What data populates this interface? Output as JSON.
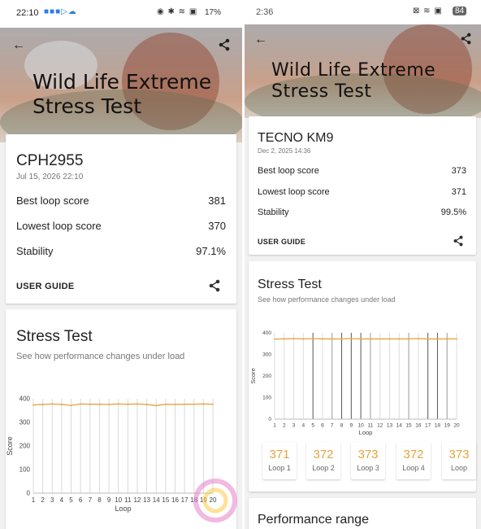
{
  "left": {
    "status": {
      "time": "22:10",
      "battery": "17%"
    },
    "title_line1": "Wild Life Extreme",
    "title_line2": "Stress Test",
    "device": "CPH2955",
    "date": "Jul 15, 2026 22:10",
    "rows": [
      {
        "label": "Best loop score",
        "value": "381"
      },
      {
        "label": "Lowest loop score",
        "value": "370"
      },
      {
        "label": "Stability",
        "value": "97.1%"
      }
    ],
    "user_guide": "USER GUIDE",
    "section_title": "Stress Test",
    "section_sub": "See how performance changes under load"
  },
  "right": {
    "status": {
      "time": "2:36",
      "battery": "84"
    },
    "title_line1": "Wild Life Extreme",
    "title_line2": "Stress Test",
    "device": "TECNO KM9",
    "date": "Dec 2, 2025 14:36",
    "rows": [
      {
        "label": "Best loop score",
        "value": "373"
      },
      {
        "label": "Lowest loop score",
        "value": "371"
      },
      {
        "label": "Stability",
        "value": "99.5%"
      }
    ],
    "user_guide": "USER GUIDE",
    "section_title": "Stress Test",
    "section_sub": "See how performance changes under load",
    "tiles": [
      {
        "value": "371",
        "label": "Loop 1"
      },
      {
        "value": "372",
        "label": "Loop 2"
      },
      {
        "value": "373",
        "label": "Loop 3"
      },
      {
        "value": "372",
        "label": "Loop 4"
      },
      {
        "value": "373",
        "label": "Loop"
      }
    ],
    "next_section_title": "Performance range"
  },
  "chart_data": [
    {
      "type": "line",
      "xlabel": "Loop",
      "ylabel": "Score",
      "x": [
        1,
        2,
        3,
        4,
        5,
        6,
        7,
        8,
        9,
        10,
        11,
        12,
        13,
        14,
        15,
        16,
        17,
        18,
        19,
        20
      ],
      "yticks": [
        0,
        100,
        200,
        300,
        400
      ],
      "ylim": [
        0,
        400
      ],
      "series": [
        {
          "values": [
            374,
            376,
            378,
            376,
            372,
            378,
            377,
            377,
            376,
            378,
            377,
            378,
            376,
            371,
            377,
            376,
            377,
            377,
            378,
            377
          ]
        }
      ],
      "color": "#e8a33d"
    },
    {
      "type": "line",
      "xlabel": "Loop",
      "ylabel": "Score",
      "x": [
        1,
        2,
        3,
        4,
        5,
        6,
        7,
        8,
        9,
        10,
        11,
        12,
        13,
        14,
        15,
        16,
        17,
        18,
        19,
        20
      ],
      "yticks": [
        0,
        100,
        200,
        300,
        400
      ],
      "ylim": [
        0,
        400
      ],
      "series": [
        {
          "values": [
            371,
            372,
            373,
            372,
            373,
            372,
            372,
            372,
            373,
            372,
            372,
            372,
            372,
            372,
            372,
            373,
            372,
            372,
            372,
            372
          ]
        }
      ],
      "color": "#e8a33d"
    }
  ],
  "icons": {
    "back": "back-arrow-icon",
    "share": "share-icon",
    "watermark": "watermark-logo-icon"
  }
}
